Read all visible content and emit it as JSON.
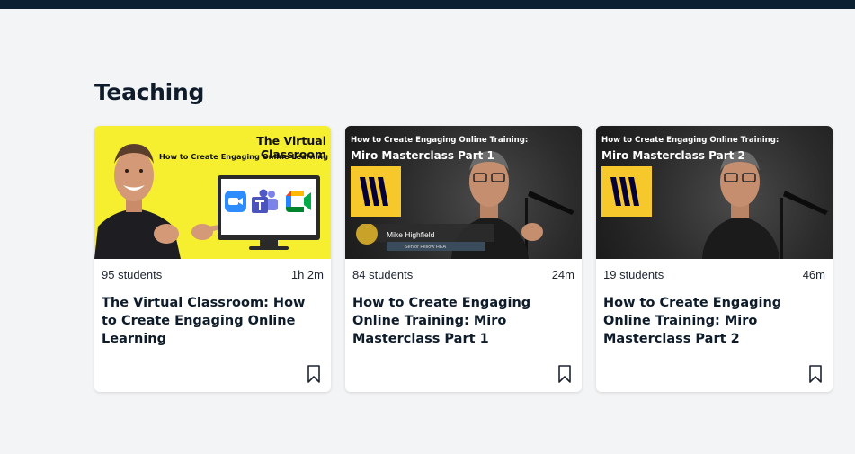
{
  "section": {
    "title": "Teaching"
  },
  "courses": [
    {
      "students": "95 students",
      "duration": "1h 2m",
      "title": "The Virtual Classroom: How to Create Engaging Online Learning",
      "thumbnail": {
        "headline": "The Virtual Classroom",
        "subheadline": "How to Create Engaging Online Learning",
        "background": "#f5ef2f",
        "icons": [
          "zoom-icon",
          "teams-icon",
          "google-meet-icon"
        ]
      }
    },
    {
      "students": "84 students",
      "duration": "24m",
      "title": "How to Create Engaging Online Training: Miro Masterclass Part 1",
      "thumbnail": {
        "kicker": "How to Create Engaging Online Training:",
        "headline": "Miro Masterclass Part 1",
        "lower_third_name": "Mike Highfield",
        "lower_third_role": "Senior Fellow HEA",
        "logo_color": "#f7c82c"
      }
    },
    {
      "students": "19 students",
      "duration": "46m",
      "title": "How to Create Engaging Online Training: Miro Masterclass Part 2",
      "thumbnail": {
        "kicker": "How to Create Engaging Online Training:",
        "headline": "Miro Masterclass Part 2",
        "logo_color": "#f7c82c"
      }
    }
  ],
  "colors": {
    "header_bar": "#0b2030",
    "page_bg": "#f3f4f5",
    "title_text": "#0d1b2a"
  }
}
